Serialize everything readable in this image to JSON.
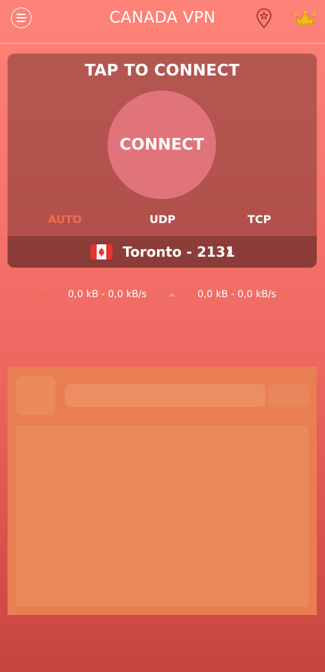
{
  "header": {
    "title": "CANADA VPN"
  },
  "connection": {
    "prompt": "TAP TO CONNECT",
    "button_label": "CONNECT",
    "protocols": [
      "AUTO",
      "UDP",
      "TCP"
    ],
    "selected_protocol": "AUTO",
    "server": "Toronto - 2131"
  },
  "traffic": {
    "download": "0,0 kB - 0,0 kB/s",
    "upload": "0,0 kB - 0,0 kB/s"
  },
  "colors": {
    "accent": "#f36a48",
    "flag_red": "#e43434",
    "crown": "#f2b81f"
  },
  "icons": {
    "menu": "menu-icon",
    "location": "location-pin-icon",
    "premium": "crown-icon",
    "server_arrow": "chevron-right-icon",
    "download": "download-arrow-icon",
    "upload": "upload-arrow-icon",
    "flag": "canada-flag-icon"
  }
}
